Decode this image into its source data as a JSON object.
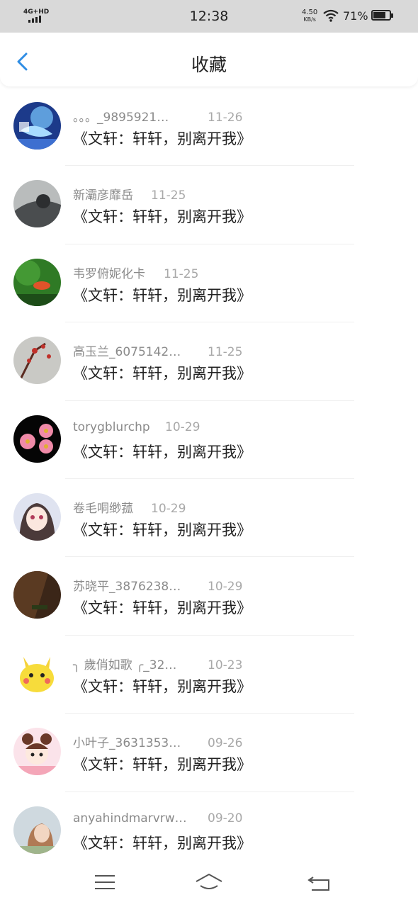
{
  "status_bar": {
    "network": "4G+HD",
    "time": "12:38",
    "speed_value": "4.50",
    "speed_unit": "KB/s",
    "battery_percent": "71%",
    "icons": [
      "signal-icon",
      "wifi-icon",
      "battery-icon"
    ]
  },
  "header": {
    "title": "收藏",
    "back_icon": "chevron-left-icon",
    "accent_color": "#2f8de4"
  },
  "favorites": [
    {
      "name": "。。。_9895921…",
      "date": "11-26",
      "article": "《文轩：轩轩，别离开我》"
    },
    {
      "name": "新灞彦靡岳",
      "date": "11-25",
      "article": "《文轩：轩轩，别离开我》"
    },
    {
      "name": "韦罗俯妮化卡",
      "date": "11-25",
      "article": "《文轩：轩轩，别离开我》"
    },
    {
      "name": "高玉兰_6075142…",
      "date": "11-25",
      "article": "《文轩：轩轩，别离开我》"
    },
    {
      "name": "torygblurchp",
      "date": "10-29",
      "article": "《文轩：轩轩，别离开我》"
    },
    {
      "name": "卷毛哃缈菰",
      "date": "10-29",
      "article": "《文轩：轩轩，别离开我》"
    },
    {
      "name": "苏晓平_3876238…",
      "date": "10-29",
      "article": "《文轩：轩轩，别离开我》"
    },
    {
      "name": "╮ 歲俏如歌 ╭_32…",
      "date": "10-23",
      "article": "《文轩：轩轩，别离开我》"
    },
    {
      "name": "小叶子_3631353…",
      "date": "09-26",
      "article": "《文轩：轩轩，别离开我》"
    },
    {
      "name": "anyahindmarvrw…",
      "date": "09-20",
      "article": "《文轩：轩轩，别离开我》"
    }
  ],
  "bottom_nav": {
    "items": [
      "menu-icon",
      "home-icon",
      "back-arrow-icon"
    ]
  }
}
